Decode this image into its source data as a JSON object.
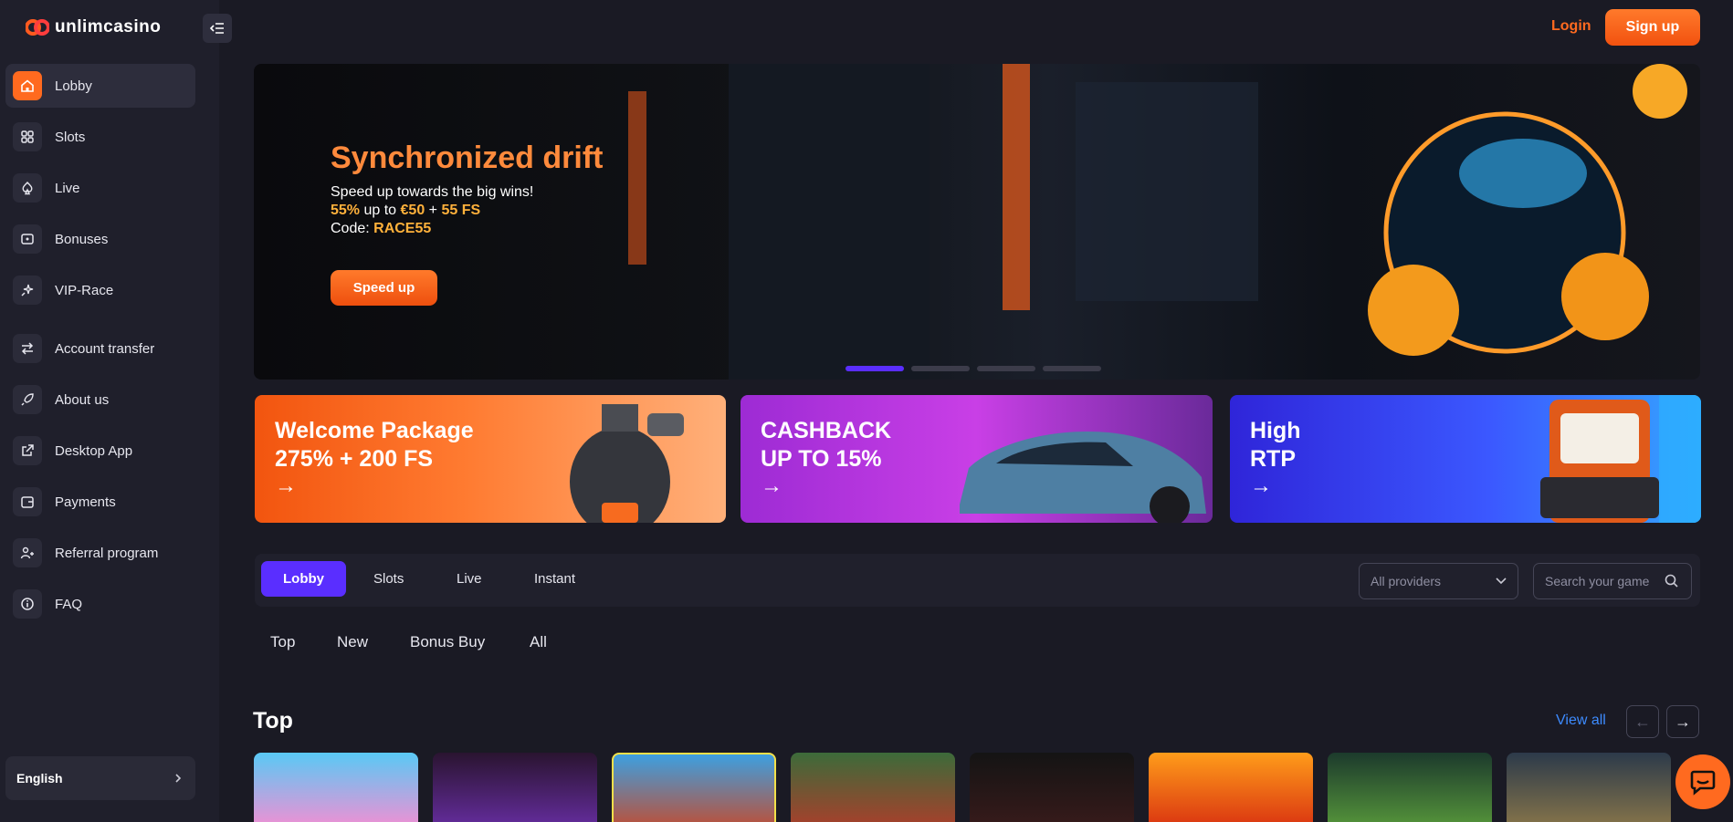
{
  "brand": {
    "name": "unlimcasino",
    "accent": "#ff6a1f",
    "primary": "#5a2eff"
  },
  "sidebar": {
    "items": [
      {
        "label": "Lobby",
        "icon": "home-icon",
        "active": true
      },
      {
        "label": "Slots",
        "icon": "grid-icon"
      },
      {
        "label": "Live",
        "icon": "spade-icon"
      },
      {
        "label": "Bonuses",
        "icon": "ticket-icon"
      },
      {
        "label": "VIP-Race",
        "icon": "sparkle-icon"
      },
      {
        "label": "Account transfer",
        "icon": "transfer-icon"
      },
      {
        "label": "About us",
        "icon": "rocket-icon"
      },
      {
        "label": "Desktop App",
        "icon": "external-icon"
      },
      {
        "label": "Payments",
        "icon": "wallet-icon"
      },
      {
        "label": "Referral program",
        "icon": "users-icon"
      },
      {
        "label": "FAQ",
        "icon": "info-icon"
      }
    ],
    "language": "English"
  },
  "header": {
    "login": "Login",
    "signup": "Sign up"
  },
  "hero": {
    "title": "Synchronized drift",
    "line1": "Speed up towards the big wins!",
    "line2_pct": "55%",
    "line2_mid": " up to ",
    "line2_amount": "€50",
    "line2_plus": " + ",
    "line2_fs": "55 FS",
    "line3_label": "Code: ",
    "line3_code": "RACE55",
    "button": "Speed up",
    "slides": 4,
    "active_slide": 1
  },
  "promos": [
    {
      "line1": "Welcome Package",
      "line2": "275% + 200 FS",
      "arrow": "→"
    },
    {
      "line1": "CASHBACK",
      "line2": "UP TO 15%",
      "arrow": "→"
    },
    {
      "line1": "High",
      "line2": "RTP",
      "arrow": "→"
    }
  ],
  "tabs": {
    "items": [
      "Lobby",
      "Slots",
      "Live",
      "Instant"
    ],
    "active": "Lobby"
  },
  "filters": {
    "providers": "All providers",
    "search_placeholder": "Search your game"
  },
  "subtabs": [
    "Top",
    "New",
    "Bonus Buy",
    "All"
  ],
  "top_section": {
    "title": "Top",
    "view_all": "View all",
    "prev": "←",
    "next": "→"
  }
}
